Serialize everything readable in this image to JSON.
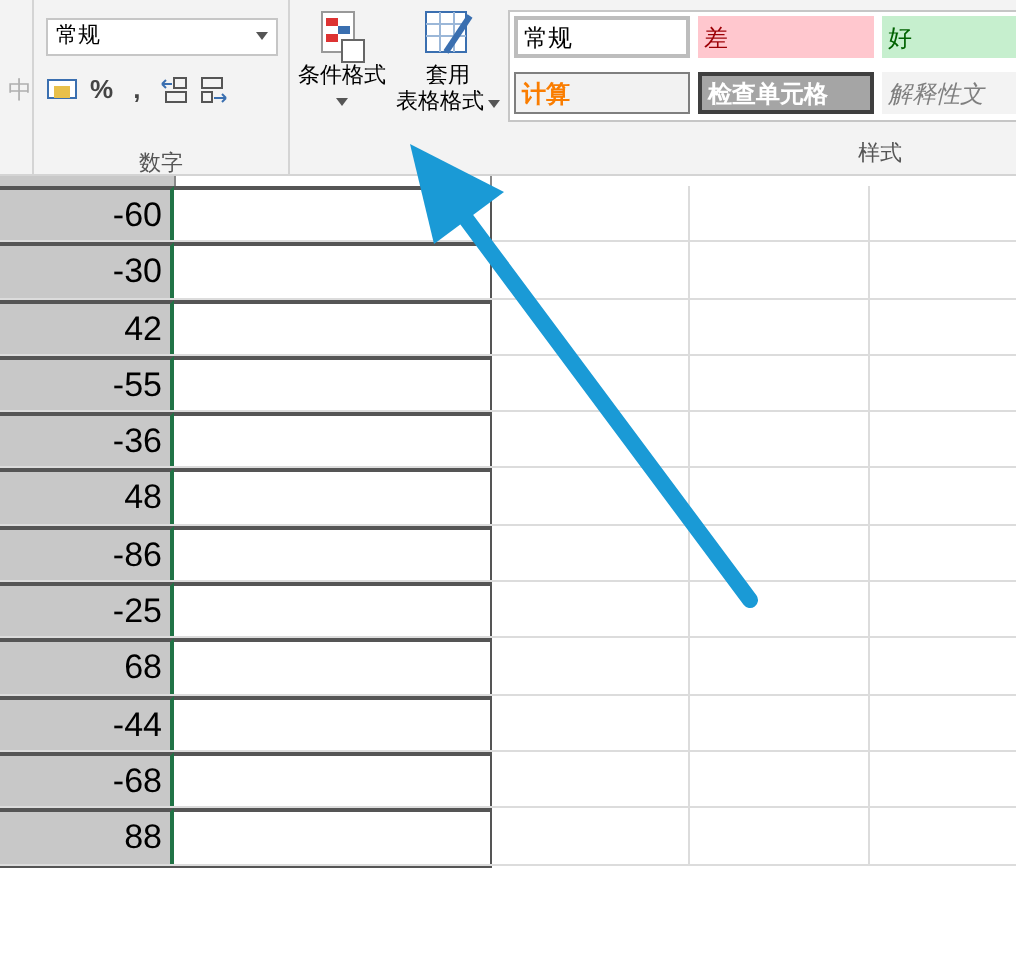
{
  "ribbon": {
    "alignment_partial": {
      "label": "中",
      "disabled": true
    },
    "number_group": {
      "format_dropdown": "常规",
      "percent": "%",
      "comma": ",",
      "label": "数字"
    },
    "conditional_format_button": "条件格式",
    "table_format_button": [
      "套用",
      "表格格式"
    ],
    "styles_group": {
      "label": "样式",
      "styles": [
        {
          "text": "常规",
          "kind": "normal"
        },
        {
          "text": "差",
          "kind": "bad"
        },
        {
          "text": "好",
          "kind": "good"
        },
        {
          "text": "计算",
          "kind": "calc"
        },
        {
          "text": "检查单元格",
          "kind": "check"
        },
        {
          "text": "解释性文",
          "kind": "explain"
        }
      ]
    }
  },
  "sheet": {
    "rows": [
      {
        "value": "-60"
      },
      {
        "value": "-30"
      },
      {
        "value": "42"
      },
      {
        "value": "-55"
      },
      {
        "value": "-36"
      },
      {
        "value": "48"
      },
      {
        "value": "-86"
      },
      {
        "value": "-25"
      },
      {
        "value": "68"
      },
      {
        "value": "-44"
      },
      {
        "value": "-68"
      },
      {
        "value": "88"
      }
    ]
  }
}
